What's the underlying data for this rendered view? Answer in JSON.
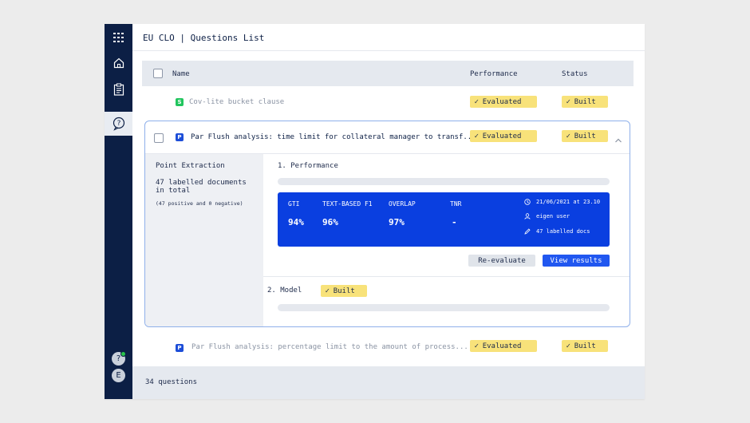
{
  "header": {
    "title": "EU CLO | Questions List"
  },
  "table": {
    "col_name": "Name",
    "col_performance": "Performance",
    "col_status": "Status"
  },
  "rows": [
    {
      "tag": "S",
      "tag_color": "#22c55e",
      "name": "Cov-lite bucket clause",
      "performance": "Evaluated",
      "status": "Built"
    },
    {
      "tag": "P",
      "tag_color": "#1d4ed8",
      "name": "Par Flush analysis: time limit for collateral manager to transf...",
      "performance": "Evaluated",
      "status": "Built"
    },
    {
      "tag": "P",
      "tag_color": "#1d4ed8",
      "name": "Par Flush analysis: percentage limit to the amount of process...",
      "performance": "Evaluated",
      "status": "Built"
    }
  ],
  "detail": {
    "type": "Point Extraction",
    "docs_count": "47 labelled documents",
    "docs_suffix": "in total",
    "docs_breakdown": "(47 positive and 0 negative)",
    "performance_heading": "1. Performance",
    "metrics": [
      {
        "label": "GTI",
        "value": "94%"
      },
      {
        "label": "TEXT-BASED F1",
        "value": "96%"
      },
      {
        "label": "OVERLAP",
        "value": "97%"
      },
      {
        "label": "TNR",
        "value": "-"
      }
    ],
    "meta_date": "21/06/2021 at 23.10",
    "meta_user": "eigen user",
    "meta_docs": "47 labelled docs",
    "reevaluate_label": "Re-evaluate",
    "view_results_label": "View results",
    "model_heading": "2. Model",
    "model_status": "Built"
  },
  "footer": {
    "count": "34 questions"
  },
  "sidebar": {
    "help_avatar": "?",
    "user_avatar": "E"
  },
  "colors": {
    "sidebar": "#0c1f45",
    "accent": "#0a3fe0",
    "badge": "#f8e27a"
  }
}
